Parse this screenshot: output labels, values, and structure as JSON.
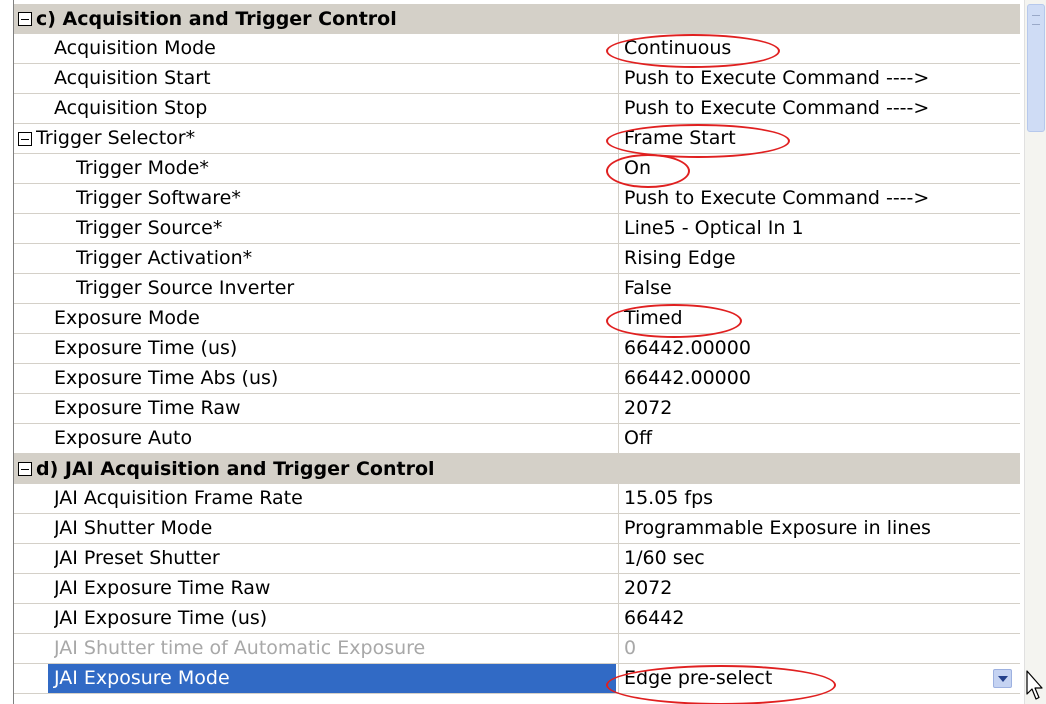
{
  "sections": [
    {
      "category": "c) Acquisition and Trigger Control",
      "rows": [
        {
          "label": "Acquisition Mode",
          "value": "Continuous"
        },
        {
          "label": "Acquisition Start",
          "value": "Push to Execute Command ---->"
        },
        {
          "label": "Acquisition Stop",
          "value": "Push to Execute Command ---->"
        },
        {
          "label": "Trigger Selector*",
          "value": "Frame Start"
        },
        {
          "label": "Trigger Mode*",
          "value": "On"
        },
        {
          "label": "Trigger Software*",
          "value": "Push to Execute Command ---->"
        },
        {
          "label": "Trigger Source*",
          "value": "Line5 - Optical In 1"
        },
        {
          "label": "Trigger Activation*",
          "value": "Rising Edge"
        },
        {
          "label": "Trigger Source Inverter",
          "value": "False"
        },
        {
          "label": "Exposure Mode",
          "value": "Timed"
        },
        {
          "label": "Exposure Time (us)",
          "value": "66442.00000"
        },
        {
          "label": "Exposure Time Abs (us)",
          "value": "66442.00000"
        },
        {
          "label": "Exposure Time Raw",
          "value": "2072"
        },
        {
          "label": "Exposure Auto",
          "value": "Off"
        }
      ]
    },
    {
      "category": "d) JAI Acquisition and Trigger Control",
      "rows": [
        {
          "label": "JAI Acquisition Frame Rate",
          "value": "15.05 fps"
        },
        {
          "label": "JAI Shutter Mode",
          "value": "Programmable Exposure in lines"
        },
        {
          "label": "JAI Preset Shutter",
          "value": "1/60 sec"
        },
        {
          "label": "JAI Exposure Time Raw",
          "value": "2072"
        },
        {
          "label": "JAI Exposure Time (us)",
          "value": "66442"
        },
        {
          "label": "JAI Shutter time of Automatic Exposure",
          "value": "0"
        },
        {
          "label": "JAI Exposure Mode",
          "value": "Edge pre-select"
        }
      ]
    }
  ],
  "colors": {
    "category_bg": "#d4d0c8",
    "selection": "#316ac5",
    "annotation_circle": "#e02020",
    "disabled_text": "#a8a8a8"
  },
  "icons": {
    "expander": "collapse-minus-icon",
    "dropdown": "chevron-down-icon",
    "cursor": "mouse-pointer-icon"
  }
}
